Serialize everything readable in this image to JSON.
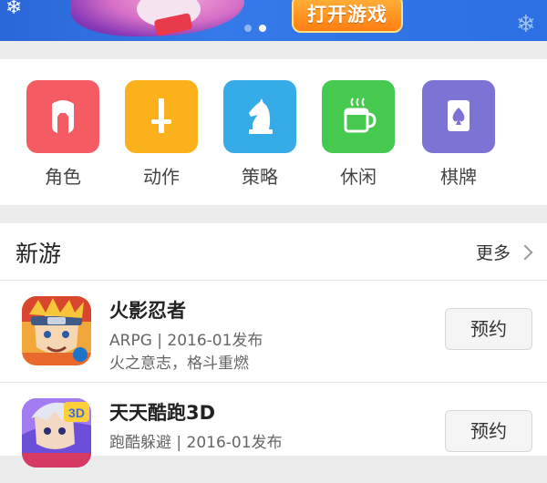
{
  "banner": {
    "cta_label": "打开游戏",
    "page_count": 2,
    "active_page": 2
  },
  "categories": [
    {
      "label": "角色",
      "color": "#f45b63",
      "icon": "helmet-icon"
    },
    {
      "label": "动作",
      "color": "#fbb11c",
      "icon": "sword-icon"
    },
    {
      "label": "策略",
      "color": "#35abe7",
      "icon": "chess-knight-icon"
    },
    {
      "label": "休闲",
      "color": "#45c94f",
      "icon": "coffee-cup-icon"
    },
    {
      "label": "棋牌",
      "color": "#7d73d4",
      "icon": "spade-card-icon"
    }
  ],
  "new_games": {
    "title": "新游",
    "more_label": "更多",
    "items": [
      {
        "name": "火影忍者",
        "meta": "ARPG | 2016-01发布",
        "desc": "火之意志，格斗重燃",
        "button": "预约"
      },
      {
        "name": "天天酷跑3D",
        "meta": "跑酷躲避 | 2016-01发布",
        "desc": "",
        "button": "预约"
      }
    ]
  }
}
